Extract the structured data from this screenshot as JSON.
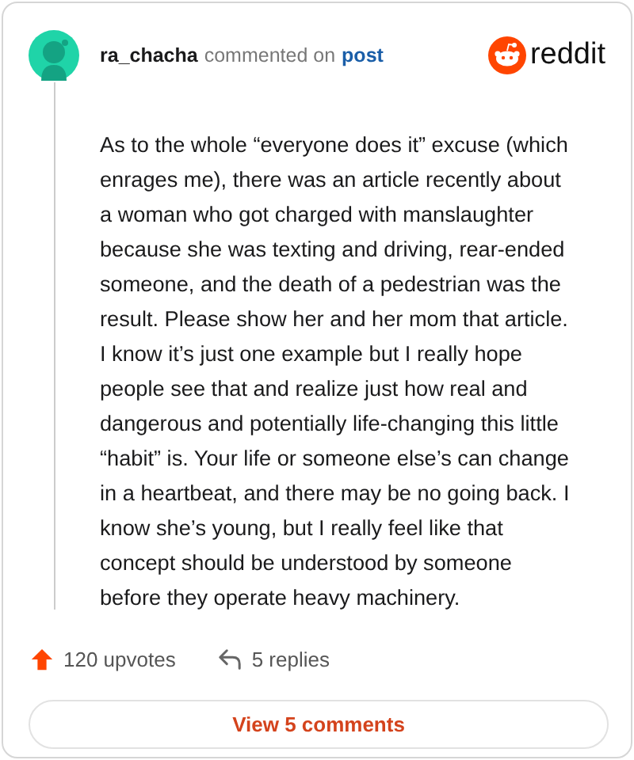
{
  "comment": {
    "author": "ra_chacha",
    "action": "commented on",
    "target": "post",
    "body": "As to the whole “everyone does it” excuse (which enrages me), there was an article recently about a woman who got charged with manslaughter because she was texting and driving, rear-ended someone, and the death of a pedestrian was the result. Please show her and her mom that article. I know it’s just one example but I really hope people see that and realize just how real and dangerous and potentially life-changing this little “habit” is. Your life or someone else’s can change in a heartbeat, and there may be no going back. I know she’s young, but I really feel like that concept should be understood by someone before they operate heavy machinery."
  },
  "brand": "reddit",
  "footer": {
    "upvotes": "120 upvotes",
    "replies": "5 replies"
  },
  "button": "View 5 comments"
}
